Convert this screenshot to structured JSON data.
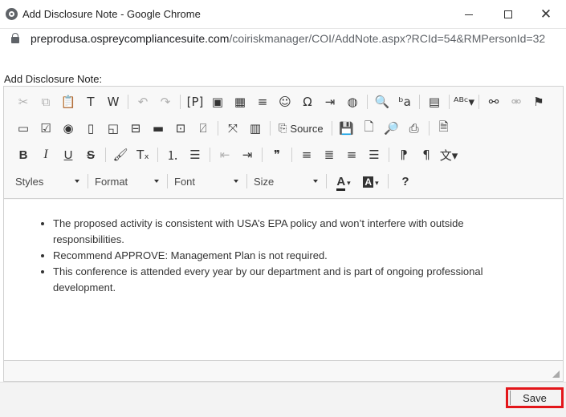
{
  "window": {
    "title": "Add Disclosure Note - Google Chrome",
    "url_host": "preprodusa.ospreycompliancesuite.com",
    "url_path": "/coiriskmanager/COI/AddNote.aspx?RCId=54&RMPersonId=32"
  },
  "page": {
    "label": "Add Disclosure Note:"
  },
  "toolbar": {
    "row1": [
      {
        "name": "cut-icon",
        "glyph": "✂",
        "disabled": true
      },
      {
        "name": "copy-icon",
        "glyph": "⧉",
        "disabled": true
      },
      {
        "name": "paste-icon",
        "glyph": "📋",
        "disabled": false
      },
      {
        "name": "paste-text-icon",
        "glyph": "T",
        "disabled": false
      },
      {
        "name": "paste-word-icon",
        "glyph": "W",
        "disabled": false
      },
      {
        "sep": true
      },
      {
        "name": "undo-icon",
        "glyph": "↶",
        "disabled": true
      },
      {
        "name": "redo-icon",
        "glyph": "↷",
        "disabled": true
      },
      {
        "sep": true
      },
      {
        "name": "placeholder-icon",
        "glyph": "[P]",
        "disabled": false
      },
      {
        "name": "image-icon",
        "glyph": "▣",
        "disabled": false
      },
      {
        "name": "table-icon",
        "glyph": "▦",
        "disabled": false
      },
      {
        "name": "horizontal-line-icon",
        "glyph": "≡",
        "disabled": false
      },
      {
        "name": "smiley-icon",
        "glyph": "☺",
        "disabled": false
      },
      {
        "name": "special-char-icon",
        "glyph": "Ω",
        "disabled": false
      },
      {
        "name": "page-break-icon",
        "glyph": "⇥",
        "disabled": false
      },
      {
        "name": "iframe-icon",
        "glyph": "◍",
        "disabled": false
      },
      {
        "sep": true
      },
      {
        "name": "find-icon",
        "glyph": "🔍",
        "disabled": false
      },
      {
        "name": "replace-icon",
        "glyph": "ᵇa",
        "disabled": false
      },
      {
        "sep": true
      },
      {
        "name": "select-all-icon",
        "glyph": "▤",
        "disabled": false
      },
      {
        "sep": true
      },
      {
        "name": "spellcheck-icon",
        "glyph": "ᴬᴮᶜ▾",
        "disabled": false
      },
      {
        "sep": true
      },
      {
        "name": "link-icon",
        "glyph": "⚯",
        "disabled": false
      },
      {
        "name": "unlink-icon",
        "glyph": "⚮",
        "disabled": true
      },
      {
        "name": "anchor-flag-icon",
        "glyph": "⚑",
        "disabled": false
      }
    ],
    "row2": [
      {
        "name": "form-icon",
        "glyph": "▭",
        "disabled": false
      },
      {
        "name": "checkbox-icon",
        "glyph": "☑",
        "disabled": false
      },
      {
        "name": "radio-icon",
        "glyph": "◉",
        "disabled": false
      },
      {
        "name": "text-field-icon",
        "glyph": "▯",
        "disabled": false
      },
      {
        "name": "textarea-icon",
        "glyph": "◱",
        "disabled": false
      },
      {
        "name": "select-icon",
        "glyph": "⊟",
        "disabled": false
      },
      {
        "name": "button-icon",
        "glyph": "▬",
        "disabled": false
      },
      {
        "name": "image-button-icon",
        "glyph": "⊡",
        "disabled": false
      },
      {
        "name": "hidden-field-icon",
        "glyph": "⍁",
        "disabled": false
      },
      {
        "sep": true
      },
      {
        "name": "maximize-icon",
        "glyph": "⤧",
        "disabled": false
      },
      {
        "name": "show-blocks-icon",
        "glyph": "▥",
        "disabled": false
      },
      {
        "sep": true
      },
      {
        "name": "source-icon",
        "glyph": "⎘",
        "label": "Source",
        "disabled": false
      },
      {
        "sep": true
      },
      {
        "name": "save-icon",
        "glyph": "💾",
        "disabled": false
      },
      {
        "name": "new-page-icon",
        "glyph": "🗋",
        "disabled": false
      },
      {
        "name": "preview-icon",
        "glyph": "🔎",
        "disabled": false
      },
      {
        "name": "print-icon",
        "glyph": "⎙",
        "disabled": false
      },
      {
        "sep": true
      },
      {
        "name": "templates-icon",
        "glyph": "🗎",
        "disabled": false
      }
    ],
    "row3": [
      {
        "name": "bold-icon",
        "glyph": "B",
        "cls": "b",
        "disabled": false
      },
      {
        "name": "italic-icon",
        "glyph": "I",
        "cls": "i",
        "disabled": false
      },
      {
        "name": "underline-icon",
        "glyph": "U",
        "cls": "u",
        "disabled": false
      },
      {
        "name": "strike-icon",
        "glyph": "S",
        "cls": "s",
        "disabled": false
      },
      {
        "sep": true
      },
      {
        "name": "copy-format-icon",
        "glyph": "🖌",
        "disabled": false
      },
      {
        "name": "remove-format-icon",
        "glyph": "Tₓ",
        "disabled": false
      },
      {
        "sep": true
      },
      {
        "name": "numbered-list-icon",
        "glyph": "⒈",
        "disabled": false
      },
      {
        "name": "bulleted-list-icon",
        "glyph": "☰",
        "disabled": false
      },
      {
        "sep": true
      },
      {
        "name": "outdent-icon",
        "glyph": "⇤",
        "disabled": true
      },
      {
        "name": "indent-icon",
        "glyph": "⇥",
        "disabled": false
      },
      {
        "sep": true
      },
      {
        "name": "blockquote-icon",
        "glyph": "❞",
        "disabled": false
      },
      {
        "sep": true
      },
      {
        "name": "align-left-icon",
        "glyph": "≡",
        "disabled": false
      },
      {
        "name": "align-center-icon",
        "glyph": "≣",
        "disabled": false
      },
      {
        "name": "align-right-icon",
        "glyph": "≡",
        "disabled": false
      },
      {
        "name": "align-justify-icon",
        "glyph": "☰",
        "disabled": false
      },
      {
        "sep": true
      },
      {
        "name": "ltr-icon",
        "glyph": "⁋",
        "disabled": false
      },
      {
        "name": "rtl-icon",
        "glyph": "¶",
        "disabled": false
      },
      {
        "name": "language-icon",
        "glyph": "文▾",
        "disabled": false
      }
    ],
    "combos": [
      {
        "name": "styles-dropdown",
        "label": "Styles",
        "width": 90
      },
      {
        "name": "format-dropdown",
        "label": "Format",
        "width": 90
      },
      {
        "name": "font-dropdown",
        "label": "Font",
        "width": 90
      },
      {
        "name": "size-dropdown",
        "label": "Size",
        "width": 90
      }
    ]
  },
  "content": {
    "items": [
      "The proposed activity is consistent with USA’s EPA policy and won’t interfere with outside responsibilities.",
      "Recommend APPROVE: Management Plan is not required.",
      "This conference is attended every year by our department and is part of ongoing professional development."
    ]
  },
  "footer": {
    "save_label": "Save"
  }
}
